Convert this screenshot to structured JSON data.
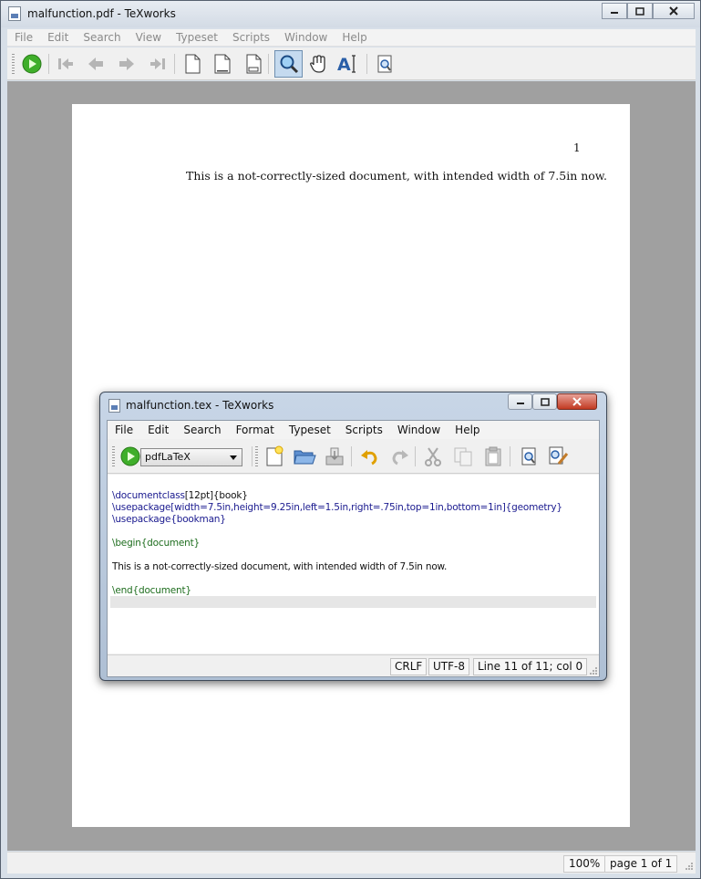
{
  "outer": {
    "title": "malfunction.pdf - TeXworks",
    "menu": [
      "File",
      "Edit",
      "Search",
      "View",
      "Typeset",
      "Scripts",
      "Window",
      "Help"
    ],
    "toolbar_icons": [
      "typeset-icon",
      "first-page-icon",
      "previous-page-icon",
      "next-page-icon",
      "last-page-icon",
      "actual-size-icon",
      "fit-width-icon",
      "fit-window-icon",
      "magnifier-icon",
      "hand-scroll-icon",
      "select-text-icon",
      "goto-source-icon"
    ],
    "pdf": {
      "page_number": "1",
      "text": "This is a not-correctly-sized document, with intended width of 7.5in now."
    },
    "status": {
      "zoom": "100%",
      "page": "page 1 of 1"
    }
  },
  "inner": {
    "title": "malfunction.tex - TeXworks",
    "menu": [
      "File",
      "Edit",
      "Search",
      "Format",
      "Typeset",
      "Scripts",
      "Window",
      "Help"
    ],
    "engine": "pdfLaTeX",
    "code": {
      "l1_cmd": "\\documentclass",
      "l1_opt": "[12pt]",
      "l1_arg": "{book}",
      "l2_cmd": "\\usepackage",
      "l2_opt": "[width=7.5in,height=9.25in,left=1.5in,right=.75in,top=1in,bottom=1in]",
      "l2_arg": "{geometry}",
      "l3_cmd": "\\usepackage",
      "l3_arg": "{bookman}",
      "l4": "\\begin{document}",
      "l5": "This is a not-correctly-sized document, with intended width of 7.5in now.",
      "l6": "\\end{document}"
    },
    "status": {
      "line_endings": "CRLF",
      "encoding": "UTF-8",
      "position": "Line 11 of 11; col 0"
    }
  },
  "colors": {
    "accent_green": "#3fae2a",
    "tex_command": "#1a1a8f",
    "tex_environment": "#1f6e1f",
    "viewport_gray": "#a0a0a0"
  }
}
